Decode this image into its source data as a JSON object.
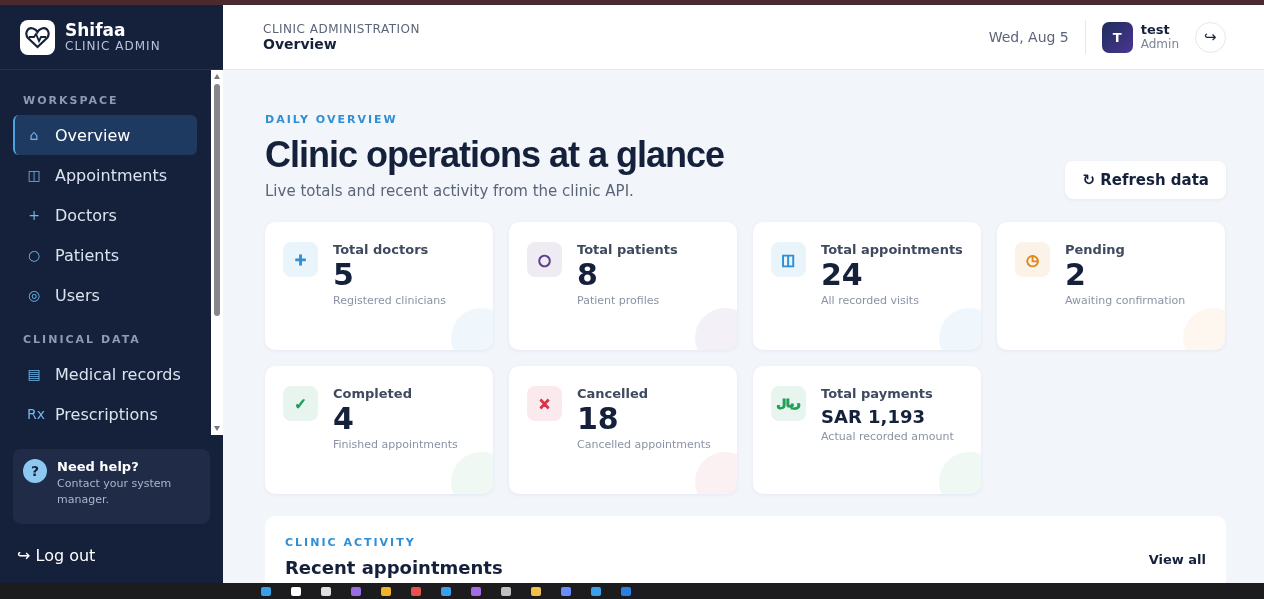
{
  "brand": {
    "name": "Shifaa",
    "subtitle": "CLINIC ADMIN"
  },
  "sidebar": {
    "sections": [
      {
        "title": "WORKSPACE",
        "items": [
          {
            "glyph": "⌂",
            "label": "Overview",
            "selected": true
          },
          {
            "glyph": "◫",
            "label": "Appointments",
            "selected": false
          },
          {
            "glyph": "+",
            "label": "Doctors",
            "selected": false
          },
          {
            "glyph": "○",
            "label": "Patients",
            "selected": false
          },
          {
            "glyph": "◎",
            "label": "Users",
            "selected": false
          }
        ]
      },
      {
        "title": "CLINICAL DATA",
        "items": [
          {
            "glyph": "▤",
            "label": "Medical records",
            "selected": false
          },
          {
            "glyph": "Rx",
            "label": "Prescriptions",
            "selected": false
          }
        ]
      }
    ],
    "help": {
      "glyph": "?",
      "title": "Need help?",
      "text": "Contact your system manager."
    },
    "logout": {
      "glyph": "↪",
      "label": "Log out"
    }
  },
  "header": {
    "eyebrow": "CLINIC ADMINISTRATION",
    "title": "Overview",
    "date": "Wed, Aug 5",
    "user": {
      "initial": "T",
      "name": "test",
      "role": "Admin"
    },
    "logout_glyph": "↪"
  },
  "hero": {
    "eyebrow": "DAILY OVERVIEW",
    "title": "Clinic operations at a glance",
    "subtitle": "Live totals and recent activity from the clinic API.",
    "refresh_button": {
      "glyph": "↻",
      "label": "Refresh data"
    }
  },
  "stats": [
    {
      "glyph": "+",
      "label": "Total doctors",
      "value": "5",
      "caption": "Registered clinicians",
      "color": "#2f8fd6"
    },
    {
      "glyph": "○",
      "label": "Total patients",
      "value": "8",
      "caption": "Patient profiles",
      "color": "#5b3f8c"
    },
    {
      "glyph": "◫",
      "label": "Total appointments",
      "value": "24",
      "caption": "All recorded visits",
      "color": "#2f8fd6"
    },
    {
      "glyph": "◷",
      "label": "Pending",
      "value": "2",
      "caption": "Awaiting confirmation",
      "color": "#e08a1e"
    },
    {
      "glyph": "✓",
      "label": "Completed",
      "value": "4",
      "caption": "Finished appointments",
      "color": "#1f9d55"
    },
    {
      "glyph": "×",
      "label": "Cancelled",
      "value": "18",
      "caption": "Cancelled appointments",
      "color": "#d9344a"
    },
    {
      "glyph": "ريال",
      "label": "Total payments",
      "value": "SAR 1,193",
      "caption": "Actual recorded amount",
      "color": "#1f9d55"
    }
  ],
  "activity": {
    "eyebrow": "CLINIC ACTIVITY",
    "title": "Recent appointments",
    "link": "View all"
  }
}
